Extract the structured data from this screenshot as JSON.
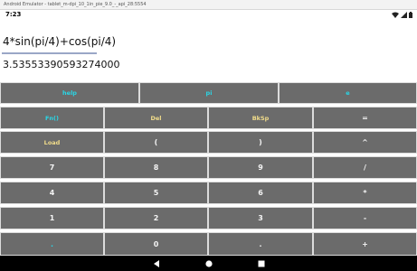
{
  "window": {
    "title": "Android Emulator - tablet_m-dpi_10_1in_pie_9.0_-_api_28:5554"
  },
  "status_bar": {
    "time": "7:23",
    "icons": [
      "wifi-icon",
      "signal-icon",
      "battery-icon"
    ]
  },
  "calculator": {
    "expression": "4*sin(pi/4)+cos(pi/4)",
    "result": "3.53553390593274000"
  },
  "keypad": {
    "row_top": [
      "help",
      "pi",
      "e"
    ],
    "rows": [
      [
        "Fn()",
        "Del",
        "BkSp",
        "="
      ],
      [
        "Load",
        "(",
        ")",
        "^"
      ],
      [
        "7",
        "8",
        "9",
        "/"
      ],
      [
        "4",
        "5",
        "6",
        "*"
      ],
      [
        "1",
        "2",
        "3",
        "-"
      ],
      [
        ".",
        "0",
        ".",
        "+"
      ]
    ]
  },
  "colors": {
    "key_background": "#6b6b6b",
    "cyan_label": "#29d6e6",
    "yellow_label": "#f1dc8a",
    "white_label": "#f4f4f4",
    "expression_underline": "#9aa7c7"
  },
  "navigation": {
    "buttons": [
      "back-icon",
      "home-icon",
      "recents-icon"
    ]
  }
}
